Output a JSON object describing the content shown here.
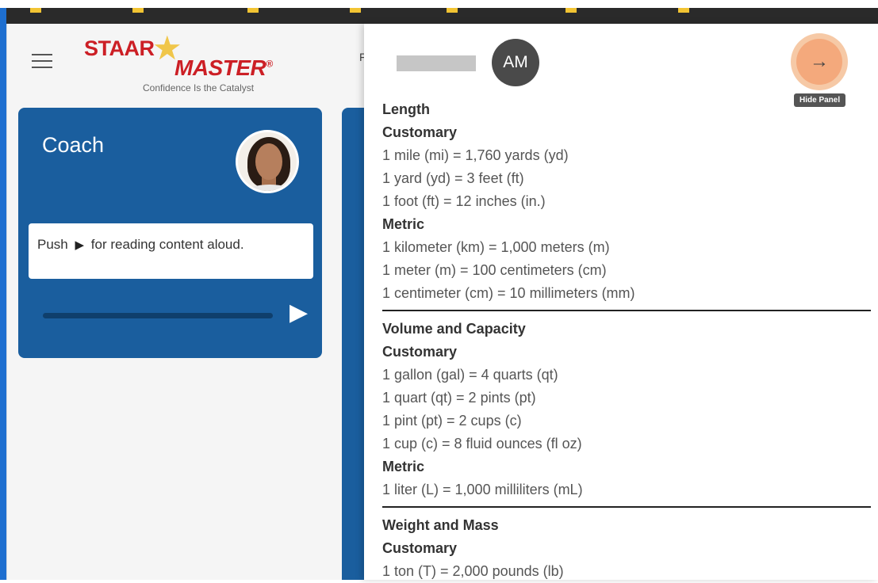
{
  "app": {
    "logo_top": "STAAR",
    "logo_bottom": "MASTER",
    "logo_reg": "®",
    "tagline": "Confidence Is the Catalyst",
    "partial_letter": "F"
  },
  "coach": {
    "title": "Coach",
    "message_prefix": "Push",
    "message_icon": "▶",
    "message_suffix": "for reading content aloud.",
    "play_icon": "▶"
  },
  "panel": {
    "user_initials": "AM",
    "hide_icon": "→",
    "hide_tooltip": "Hide Panel",
    "sections": [
      {
        "title": "Length",
        "groups": [
          {
            "name": "Customary",
            "items": [
              "1 mile (mi) = 1,760 yards (yd)",
              "1 yard (yd) = 3 feet (ft)",
              "1 foot (ft) = 12 inches (in.)"
            ]
          },
          {
            "name": "Metric",
            "items": [
              "1 kilometer (km) = 1,000 meters (m)",
              "1 meter (m) = 100 centimeters (cm)",
              "1 centimeter (cm) = 10 millimeters (mm)"
            ]
          }
        ]
      },
      {
        "title": "Volume and Capacity",
        "groups": [
          {
            "name": "Customary",
            "items": [
              "1 gallon (gal) = 4 quarts (qt)",
              "1 quart (qt) = 2 pints (pt)",
              "1 pint (pt) = 2 cups (c)",
              "1 cup (c) = 8 fluid ounces (fl oz)"
            ]
          },
          {
            "name": "Metric",
            "items": [
              "1 liter (L) = 1,000 milliliters (mL)"
            ]
          }
        ]
      },
      {
        "title": "Weight and Mass",
        "groups": [
          {
            "name": "Customary",
            "items": [
              "1 ton (T) = 2,000 pounds (lb)"
            ]
          }
        ]
      }
    ]
  },
  "colors": {
    "card_blue": "#1a5e9e",
    "logo_red": "#cc1f25",
    "hide_button_orange": "#f4a97c"
  }
}
